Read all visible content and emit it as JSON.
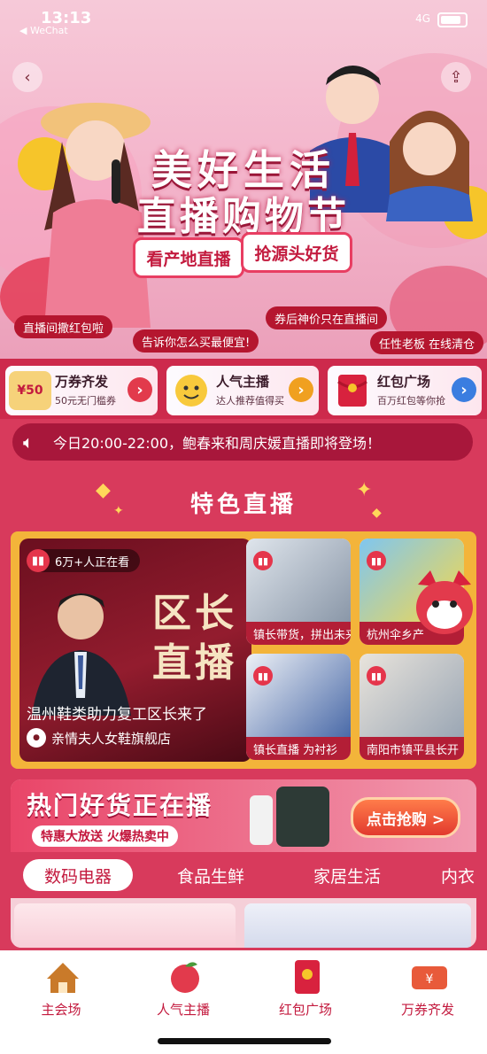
{
  "status": {
    "time": "13:13",
    "back_label": "◀ WeChat",
    "signal": "4G"
  },
  "hero": {
    "title_line1": "美好生活",
    "title_line2": "直播购物节",
    "chip_left": "看产地直播",
    "chip_right": "抢源头好货",
    "tags": [
      "直播间撒红包啦",
      "告诉你怎么买最便宜!",
      "券后神价只在直播间",
      "任性老板 在线清仓"
    ]
  },
  "features": [
    {
      "title": "万券齐发",
      "subtitle": "50元无门槛券",
      "icon": "coupon-icon",
      "badge": "¥50"
    },
    {
      "title": "人气主播",
      "subtitle": "达人推荐值得买",
      "icon": "smiley-icon"
    },
    {
      "title": "红包广场",
      "subtitle": "百万红包等你抢",
      "icon": "red-envelope-icon"
    }
  ],
  "notice": {
    "text": "今日20:00-22:00，鲍春来和周庆媛直播即将登场！"
  },
  "featured": {
    "title": "特色直播",
    "main": {
      "viewers": "6万+人正在看",
      "poster_line1": "区长",
      "poster_line2": "直播",
      "caption": "温州鞋类助力复工区长来了",
      "shop": "亲情夫人女鞋旗舰店"
    },
    "small": [
      {
        "label": "镇长带货，拼出未来"
      },
      {
        "label": "杭州伞乡产"
      },
      {
        "label": "镇长直播 为衬衫"
      },
      {
        "label": "南阳市镇平县长开"
      }
    ]
  },
  "hot": {
    "title": "热门好货正在播",
    "subtitle": "特惠大放送 火爆热卖中",
    "cta": "点击抢购 >",
    "tabs": [
      "数码电器",
      "食品生鲜",
      "家居生活",
      "内衣"
    ],
    "active_tab": "数码电器"
  },
  "bottom_nav": [
    {
      "label": "主会场",
      "icon": "home-icon"
    },
    {
      "label": "人气主播",
      "icon": "peach-icon"
    },
    {
      "label": "红包广场",
      "icon": "red-envelope-icon"
    },
    {
      "label": "万券齐发",
      "icon": "coupon-icon"
    }
  ],
  "colors": {
    "brand_red": "#c31a3e",
    "page_bg": "#d83a5c",
    "gold": "#f3b43a"
  }
}
